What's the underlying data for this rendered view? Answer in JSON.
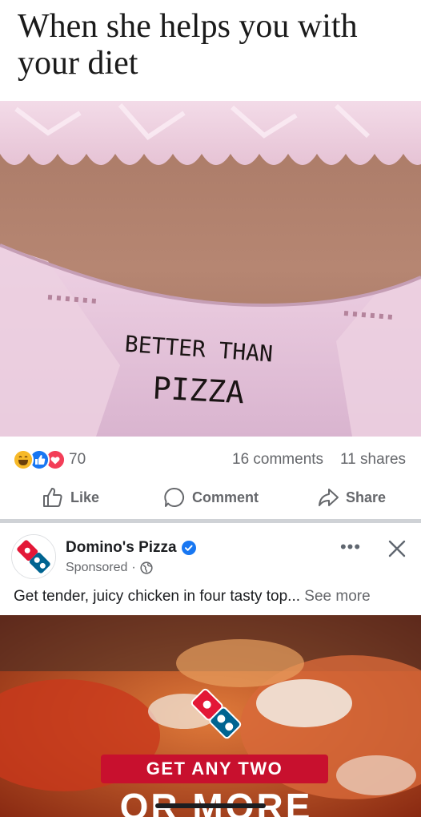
{
  "meme_post": {
    "caption": "When she helps you with your diet",
    "handwritten_text_line1": "BETTER THAN",
    "handwritten_text_line2": "PIZZA"
  },
  "stats": {
    "reactions": [
      "haha",
      "like",
      "love"
    ],
    "reaction_count": "70",
    "comments": "16 comments",
    "shares": "11 shares"
  },
  "actions": {
    "like": "Like",
    "comment": "Comment",
    "share": "Share"
  },
  "ad": {
    "page_name": "Domino's Pizza",
    "sponsored": "Sponsored",
    "dot": "·",
    "text": "Get tender, juicy chicken in four tasty top...",
    "see_more": "See more",
    "banner_line1": "GET ANY TWO",
    "banner_line2": "OR MORE",
    "more_label": "•••"
  },
  "colors": {
    "fb_blue": "#1877f2",
    "dominos_blue": "#006491",
    "dominos_red": "#e31837",
    "muted_text": "#65676b"
  }
}
